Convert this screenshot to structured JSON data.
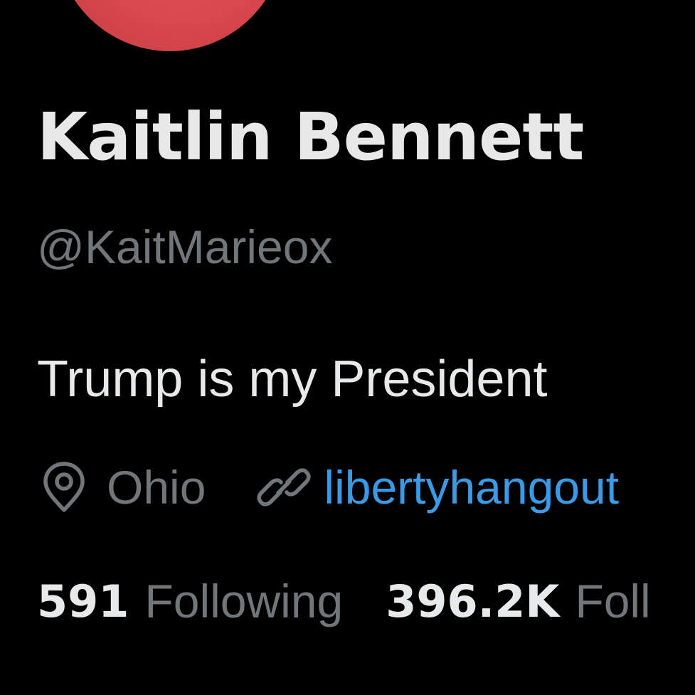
{
  "profile": {
    "display_name": "Kaitlin Bennett",
    "handle": "@KaitMarieox",
    "bio": "Trump is my President",
    "avatar_color": "#d8484e"
  },
  "meta": {
    "location_icon": "location-pin-icon",
    "location": "Ohio",
    "link_icon": "link-icon",
    "link": "libertyhangout",
    "link_color": "#3a9ae6"
  },
  "stats": {
    "following_count": "591",
    "following_label": "Following",
    "followers_count": "396.2K",
    "followers_label": "Foll"
  },
  "colors": {
    "background": "#000000",
    "primary_text": "#e7e9ea",
    "secondary_text": "#71767b"
  }
}
